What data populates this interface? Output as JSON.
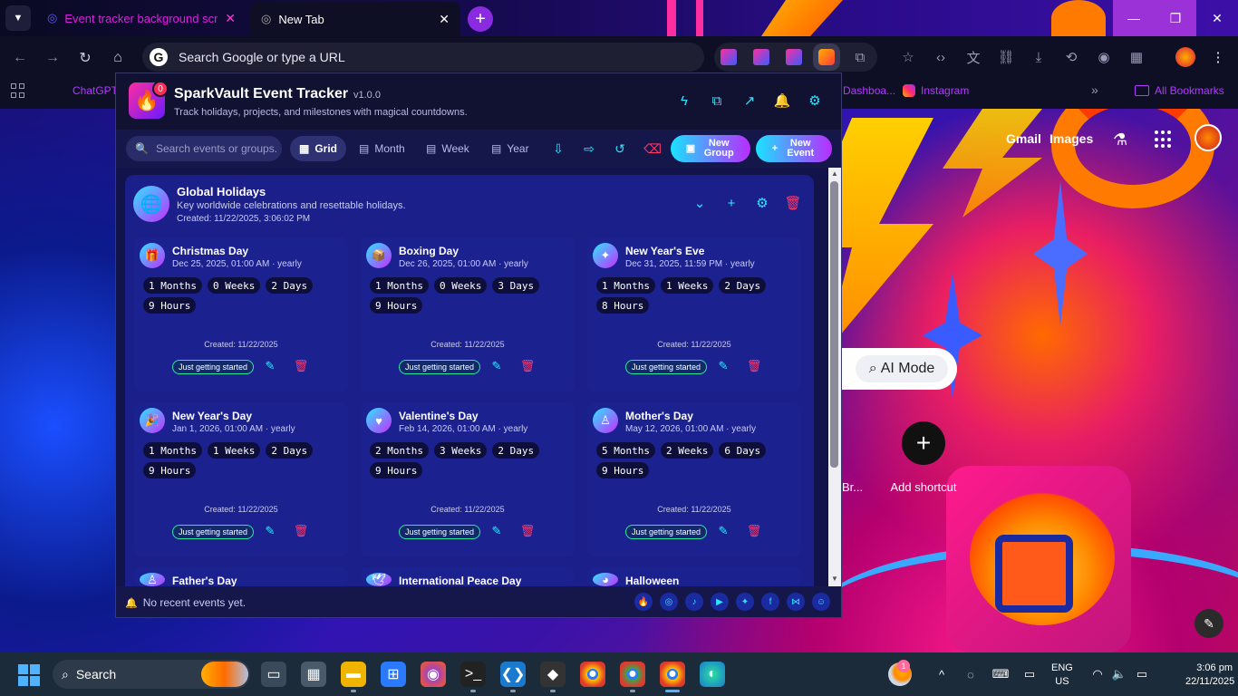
{
  "browser": {
    "tabs": [
      {
        "title": "Event tracker background script",
        "active": false
      },
      {
        "title": "New Tab",
        "active": true
      }
    ],
    "omnibox_placeholder": "Search Google or type a URL",
    "bookmarks": [
      {
        "label": "ChatGPT"
      },
      {
        "label": "Dashboa..."
      },
      {
        "label": "Instagram"
      }
    ],
    "all_bookmarks_label": "All Bookmarks"
  },
  "newtab": {
    "gmail_label": "Gmail",
    "images_label": "Images",
    "ai_mode_label": "AI Mode",
    "add_shortcut_label": "Add shortcut",
    "partial_shortcut_label": "Br..."
  },
  "extension": {
    "title": "SparkVault Event Tracker",
    "version": "v1.0.0",
    "subtitle": "Track holidays, projects, and milestones with magical countdowns.",
    "notification_count": "0",
    "search_placeholder": "Search events or groups...",
    "views": [
      {
        "label": "Grid",
        "active": true
      },
      {
        "label": "Month",
        "active": false
      },
      {
        "label": "Week",
        "active": false
      },
      {
        "label": "Year",
        "active": false
      }
    ],
    "new_group_label": "New Group",
    "new_event_label": "New Event",
    "group": {
      "title": "Global Holidays",
      "description": "Key worldwide celebrations and resettable holidays.",
      "created": "Created: 11/22/2025, 3:06:02 PM"
    },
    "events": [
      {
        "name": "Christmas Day",
        "date": "Dec 25, 2025, 01:00 AM · yearly",
        "chips": [
          "1 Months",
          "0 Weeks",
          "2 Days",
          "9 Hours"
        ],
        "created": "Created: 11/22/2025",
        "badge": "Just getting started",
        "icon": "gift-icon"
      },
      {
        "name": "Boxing Day",
        "date": "Dec 26, 2025, 01:00 AM · yearly",
        "chips": [
          "1 Months",
          "0 Weeks",
          "3 Days",
          "9 Hours"
        ],
        "created": "Created: 11/22/2025",
        "badge": "Just getting started",
        "icon": "box-icon"
      },
      {
        "name": "New Year's Eve",
        "date": "Dec 31, 2025, 11:59 PM · yearly",
        "chips": [
          "1 Months",
          "1 Weeks",
          "2 Days",
          "8 Hours"
        ],
        "created": "Created: 11/22/2025",
        "badge": "Just getting started",
        "icon": "sparkle-icon"
      },
      {
        "name": "New Year's Day",
        "date": "Jan 1, 2026, 01:00 AM · yearly",
        "chips": [
          "1 Months",
          "1 Weeks",
          "2 Days",
          "9 Hours"
        ],
        "created": "Created: 11/22/2025",
        "badge": "Just getting started",
        "icon": "party-icon"
      },
      {
        "name": "Valentine's Day",
        "date": "Feb 14, 2026, 01:00 AM · yearly",
        "chips": [
          "2 Months",
          "3 Weeks",
          "2 Days",
          "9 Hours"
        ],
        "created": "Created: 11/22/2025",
        "badge": "Just getting started",
        "icon": "heart-icon"
      },
      {
        "name": "Mother's Day",
        "date": "May 12, 2026, 01:00 AM · yearly",
        "chips": [
          "5 Months",
          "2 Weeks",
          "6 Days",
          "9 Hours"
        ],
        "created": "Created: 11/22/2025",
        "badge": "Just getting started",
        "icon": "person-icon"
      },
      {
        "name": "Father's Day",
        "icon": "person-icon"
      },
      {
        "name": "International Peace Day",
        "icon": "dove-icon"
      },
      {
        "name": "Halloween",
        "icon": "pumpkin-icon"
      }
    ],
    "footer_text": "No recent events yet."
  },
  "taskbar": {
    "search_label": "Search",
    "weather_badge": "1",
    "lang_line1": "ENG",
    "lang_line2": "US",
    "time": "3:06 pm",
    "date": "22/11/2025"
  },
  "colors": {
    "accent_cyan": "#2ee6ff",
    "accent_purple": "#b92cff",
    "danger": "#ff3a6a",
    "card_bg": "#1c2190"
  }
}
